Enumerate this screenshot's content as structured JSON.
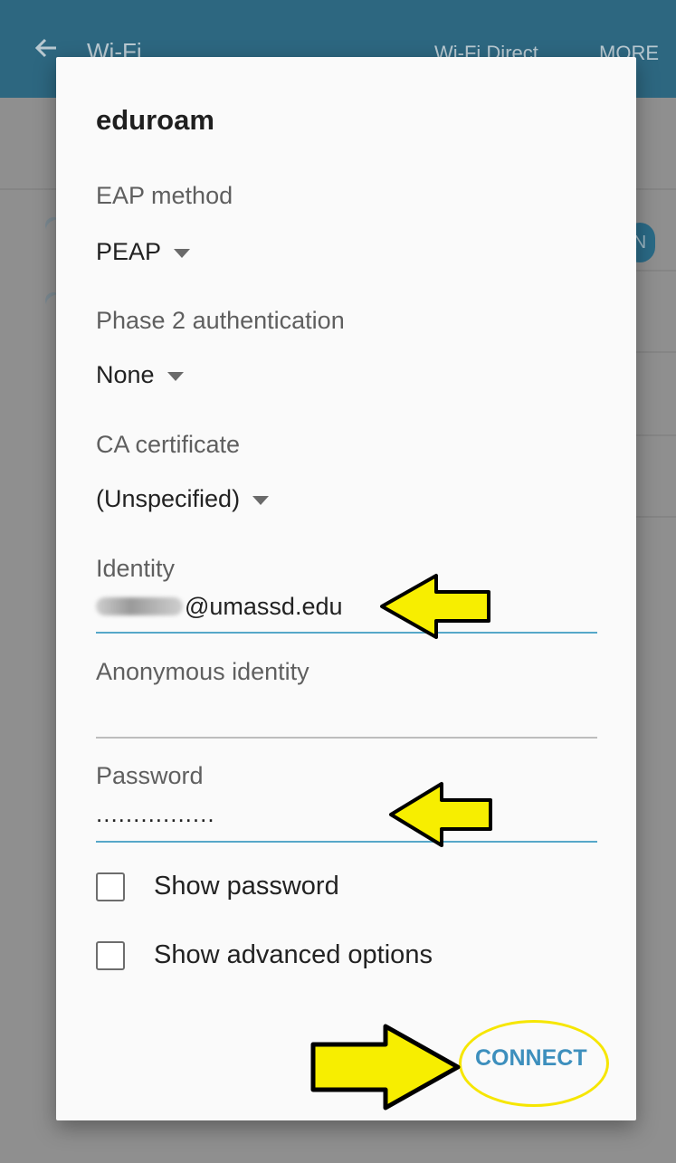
{
  "app_bar": {
    "title": "Wi-Fi",
    "wifi_direct": "Wi-Fi Direct",
    "more": "MORE",
    "toggle_text": "N"
  },
  "dialog": {
    "title": "eduroam",
    "eap_method": {
      "label": "EAP method",
      "value": "PEAP"
    },
    "phase2": {
      "label": "Phase 2 authentication",
      "value": "None"
    },
    "ca_certificate": {
      "label": "CA certificate",
      "value": "(Unspecified)"
    },
    "identity": {
      "label": "Identity",
      "value": "@umassd.edu"
    },
    "anonymous_identity": {
      "label": "Anonymous identity",
      "value": ""
    },
    "password": {
      "label": "Password",
      "value": "................"
    },
    "show_password": {
      "label": "Show password",
      "checked": false
    },
    "show_advanced": {
      "label": "Show advanced options",
      "checked": false
    },
    "connect_label": "CONNECT"
  },
  "colors": {
    "app_bar": "#2d6780",
    "accent": "#56a7c9",
    "connect": "#3d8fbd",
    "highlight": "#f6e600"
  }
}
